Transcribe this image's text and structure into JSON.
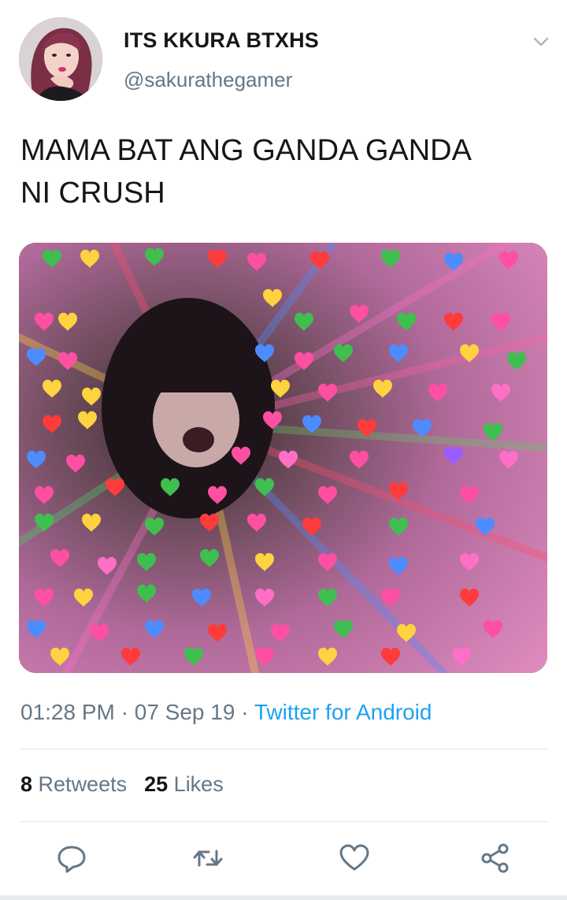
{
  "user": {
    "display_name": "ITS KKURA BTXHS",
    "handle": "@sakurathegamer",
    "avatar_icon": "profile-photo"
  },
  "tweet": {
    "text": "MAMA BAT ANG GANDA GANDA\nNI CRUSH"
  },
  "meta": {
    "time": "01:28 PM",
    "separator": " · ",
    "date": "07 Sep 19",
    "source": "Twitter for Android"
  },
  "stats": {
    "retweets_count": "8",
    "retweets_label": "Retweets",
    "likes_count": "25",
    "likes_label": "Likes"
  },
  "icons": {
    "more": "chevron-down-icon",
    "reply": "reply-icon",
    "retweet": "retweet-icon",
    "like": "heart-icon",
    "share": "share-icon"
  },
  "colors": {
    "link": "#1da1f2",
    "secondary_text": "#657786",
    "primary_text": "#14171a",
    "divider": "#e1e8ed"
  }
}
